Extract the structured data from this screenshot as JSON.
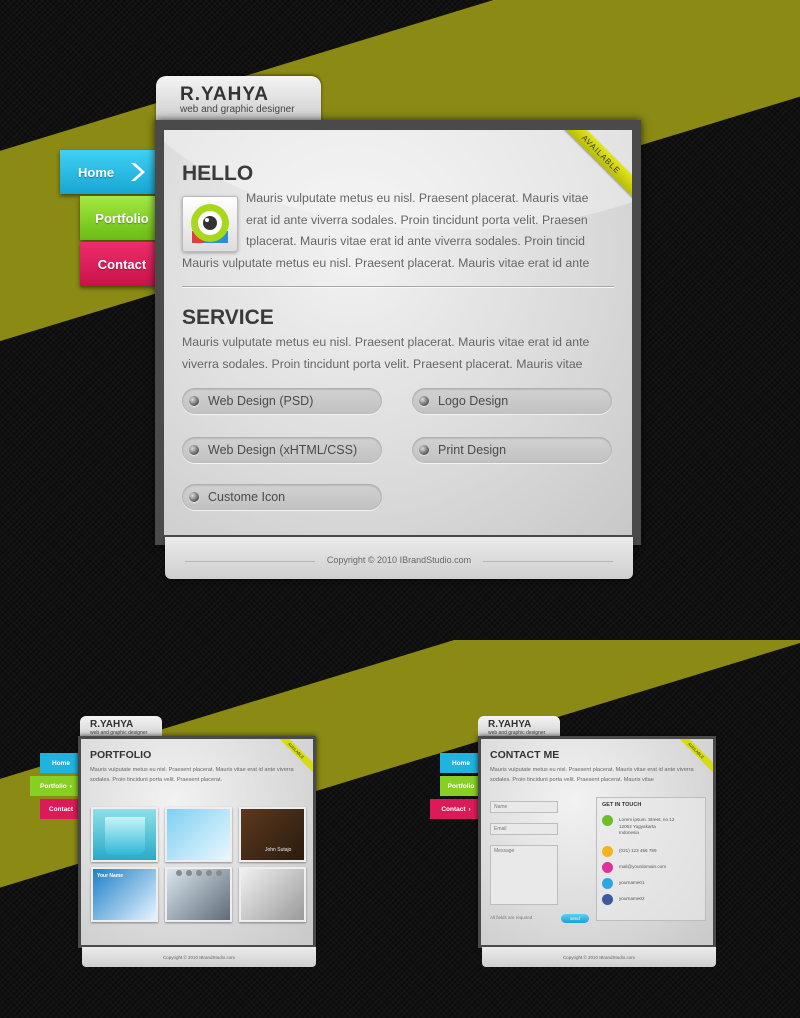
{
  "brand": {
    "name": "R.YAHYA",
    "tagline": "web and graphic designer"
  },
  "nav": {
    "home": "Home",
    "portfolio": "Portfolio",
    "contact": "Contact"
  },
  "badge": "AVAILABLE",
  "colors": {
    "stripe": "#8a8a15",
    "home": "#1fb4e0",
    "portfolio": "#86cf23",
    "contact": "#dc1a5a",
    "ribbon": "#d7db12"
  },
  "hello": {
    "title": "HELLO",
    "paragraph_lines": [
      "Mauris vulputate metus eu nisl. Praesent placerat. Mauris vitae",
      "erat id ante viverra sodales. Proin tincidunt porta velit. Praesen",
      "tplacerat. Mauris vitae erat id ante viverra sodales. Proin tincid",
      "Mauris vulputate metus eu nisl. Praesent placerat. Mauris vitae erat id ante"
    ]
  },
  "service": {
    "title": "SERVICE",
    "paragraph_lines": [
      "Mauris vulputate metus eu nisl. Praesent placerat. Mauris vitae erat id ante",
      "viverra sodales. Proin tincidunt porta velit. Praesent placerat. Mauris vitae"
    ],
    "items": [
      "Web Design (PSD)",
      "Logo Design",
      "Web Design (xHTML/CSS)",
      "Print Design",
      "Custome Icon"
    ]
  },
  "footer": {
    "copyright": "Copyright © 2010 IBrandStudio.com"
  },
  "portfolio_page": {
    "title": "PORTFOLIO",
    "paragraph": "Mauris vulputate metus eu nisl. Praesent placerat. Mauris vitae erat id ante viverra sodales. Proin tincidunt porta velit. Praesent placerat.",
    "thumb_captions": [
      "John Sutajo",
      "Your Name"
    ],
    "page_dots": 5
  },
  "contact_page": {
    "title": "CONTACT ME",
    "paragraph": "Mauris vulputate metus eu nisl. Praesent placerat. Mauris vitae erat id ante viverra sodales. Proin tincidunt porta velit. Praesent placerat. Mauris vitae",
    "name_placeholder": "Name",
    "email_placeholder": "Email",
    "message_placeholder": "Message",
    "required_note": "All fields are required",
    "send": "send",
    "get_in_touch": "GET IN TOUCH",
    "address_lines": [
      "Lorem ipsum. Street, no 12",
      "12062 Yogyakarta",
      "Indonesia"
    ],
    "phone": "(021) 123 456 789",
    "email": "mail@yourdomain.com",
    "skype": "yourname01",
    "facebook": "yourname02"
  }
}
